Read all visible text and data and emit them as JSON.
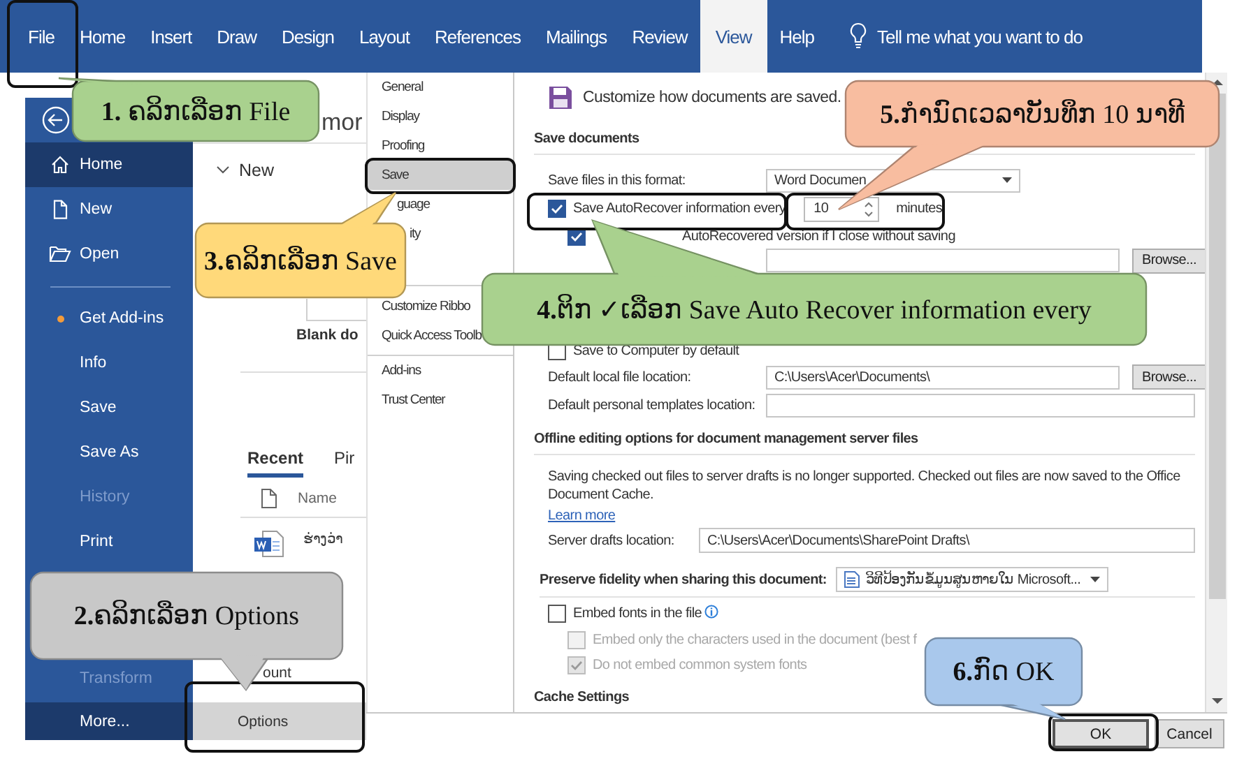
{
  "ribbon": {
    "tabs": [
      {
        "label": "File",
        "selected": false
      },
      {
        "label": "Home",
        "selected": false
      },
      {
        "label": "Insert",
        "selected": false
      },
      {
        "label": "Draw",
        "selected": false
      },
      {
        "label": "Design",
        "selected": false
      },
      {
        "label": "Layout",
        "selected": false
      },
      {
        "label": "References",
        "selected": false
      },
      {
        "label": "Mailings",
        "selected": false
      },
      {
        "label": "Review",
        "selected": false
      },
      {
        "label": "View",
        "selected": true
      },
      {
        "label": "Help",
        "selected": false
      }
    ],
    "tell_me": "Tell me what you want to do"
  },
  "backstage": {
    "greeting_fragment": "mor",
    "nav": [
      {
        "label": "Home",
        "selected": true,
        "disabled": false,
        "notification": false
      },
      {
        "label": "New",
        "selected": false,
        "disabled": false,
        "notification": false
      },
      {
        "label": "Open",
        "selected": false,
        "disabled": false,
        "notification": false
      },
      {
        "label": "Get Add-ins",
        "selected": false,
        "disabled": false,
        "notification": true
      },
      {
        "label": "Info",
        "selected": false,
        "disabled": false,
        "notification": false
      },
      {
        "label": "Save",
        "selected": false,
        "disabled": false,
        "notification": false
      },
      {
        "label": "Save As",
        "selected": false,
        "disabled": false,
        "notification": false
      },
      {
        "label": "History",
        "selected": false,
        "disabled": true,
        "notification": false
      },
      {
        "label": "Print",
        "selected": false,
        "disabled": false,
        "notification": false
      },
      {
        "label": "Transform",
        "selected": false,
        "disabled": true,
        "notification": false
      }
    ],
    "more": "More...",
    "new_heading": "New",
    "blank_label": "Blank do",
    "recent_tabs": [
      {
        "label": "Recent",
        "selected": true
      },
      {
        "label": "Pir",
        "selected": false
      }
    ],
    "name_column": "Name",
    "file_name": "ຮ່າງວ່າ",
    "account_fragment": "ount",
    "options": "Options"
  },
  "options": {
    "categories": [
      {
        "label": "General",
        "selected": false,
        "kind": "item",
        "separated": false
      },
      {
        "label": "Display",
        "selected": false,
        "kind": "item",
        "separated": false
      },
      {
        "label": "Proofing",
        "selected": false,
        "kind": "item",
        "separated": false
      },
      {
        "label": "Save",
        "selected": true,
        "kind": "item",
        "separated": false
      },
      {
        "label": "guage",
        "selected": false,
        "kind": "partial",
        "separated": false
      },
      {
        "label": "ity",
        "selected": false,
        "kind": "partial",
        "separated": false
      },
      {
        "label": "Customize Ribbo",
        "selected": false,
        "kind": "item",
        "separated": true
      },
      {
        "label": "Quick Access Toolb",
        "selected": false,
        "kind": "item",
        "separated": false
      },
      {
        "label": "Add-ins",
        "selected": false,
        "kind": "item",
        "separated": true
      },
      {
        "label": "Trust Center",
        "selected": false,
        "kind": "item",
        "separated": false
      }
    ],
    "header": "Customize how documents are saved.",
    "save_documents": {
      "heading": "Save documents",
      "format_label": "Save files in this format:",
      "format_value": "Word Documen",
      "autorecover": {
        "label": "Save AutoRecover information every",
        "checked": true,
        "minutes": "10",
        "unit": "minutes"
      },
      "keep_last": {
        "label": "AutoRecovered version if I close without saving",
        "checked": true
      },
      "location_browse": "Browse...",
      "computer_default": {
        "label": "Save to Computer by default",
        "checked": false
      },
      "local_label": "Default local file location:",
      "local_value": "C:\\Users\\Acer\\Documents\\",
      "local_browse": "Browse...",
      "templates_label": "Default personal templates location:"
    },
    "offline": {
      "heading": "Offline editing options for document management server files",
      "text": "Saving checked out files to server drafts is no longer supported. Checked out files are now saved to the Office Document Cache.",
      "link": "Learn more",
      "drafts_label": "Server drafts location:",
      "drafts_value": "C:\\Users\\Acer\\Documents\\SharePoint Drafts\\"
    },
    "fidelity": {
      "heading": "Preserve fidelity when sharing this document:",
      "document": "ວິທີປ້ອງກັນຂໍ້ມູນສູນຫາຍໃນ Microsoft...",
      "embed": {
        "label": "Embed fonts in the file",
        "checked": false,
        "disabled": false,
        "children": [
          {
            "label": "Embed only the characters used in the document (best f",
            "checked": false,
            "disabled": true
          },
          {
            "label": "Do not embed common system fonts",
            "checked": true,
            "disabled": true
          }
        ]
      }
    },
    "cache_heading": "Cache Settings",
    "buttons": [
      {
        "label": "OK",
        "kind": "default"
      },
      {
        "label": "Cancel",
        "kind": "normal"
      }
    ]
  },
  "callouts": [
    {
      "text": "**1.** ຄລິກເລືອກ File",
      "color": "#a9d18e"
    },
    {
      "text": "**2.**ຄລິກເລືອກ Options",
      "color": "#c8c8c8"
    },
    {
      "text": "**3.**ຄລິກເລືອກ Save",
      "color": "#ffd97a"
    },
    {
      "text": "**4.**ຕິກ ✓ເລືອກ Save Auto Recover information every",
      "color": "#a9d18e"
    },
    {
      "text": "**5.**ກຳນົດເວລາບັນທຶກ 10 ນາທີ",
      "color": "#f8bda0"
    },
    {
      "text": "**6.**ກົດ OK",
      "color": "#a9c8ec"
    }
  ]
}
